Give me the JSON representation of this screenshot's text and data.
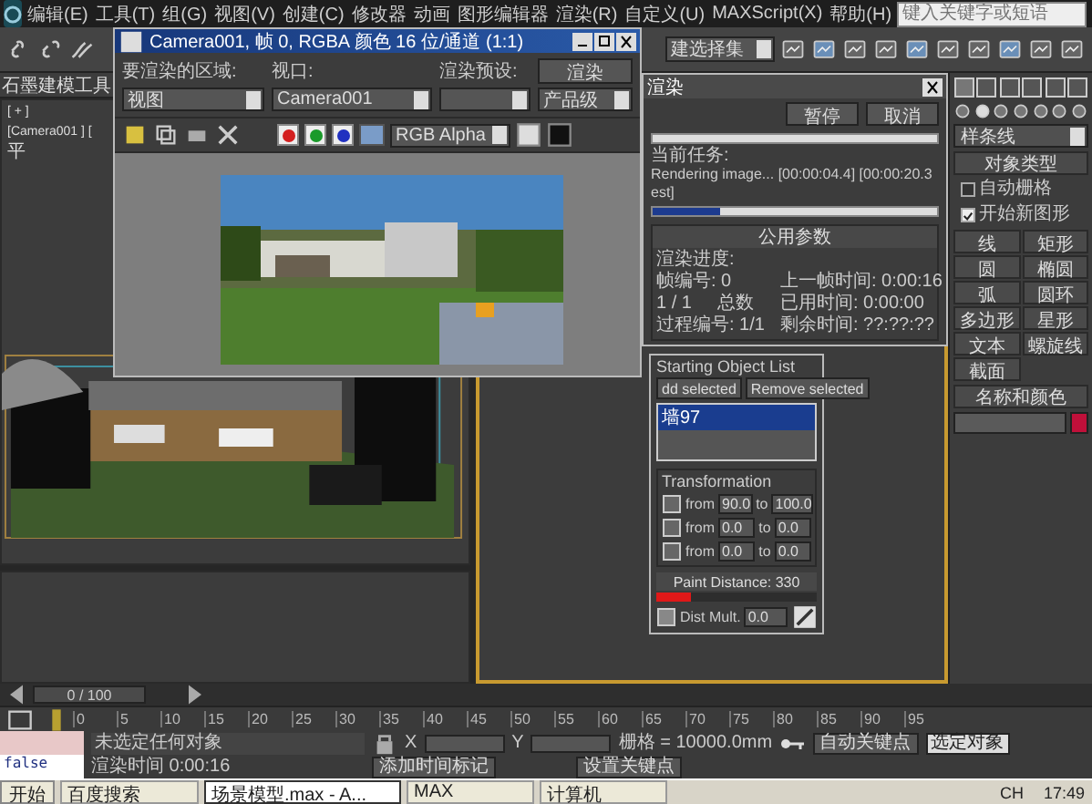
{
  "menu_bar": {
    "items": [
      "编辑(E)",
      "工具(T)",
      "组(G)",
      "视图(V)",
      "创建(C)",
      "修改器",
      "动画",
      "图形编辑器",
      "渲染(R)",
      "自定义(U)",
      "MAXScript(X)",
      "帮助(H)"
    ],
    "search_placeholder": "键入关键字或短语"
  },
  "toolbar": {
    "selection_set": "建选择集"
  },
  "ribbon": {
    "tab": "石墨建模工具"
  },
  "viewport": {
    "label": "[ + ] [Camera001 ] [ 平"
  },
  "frame_window": {
    "title": "Camera001, 帧 0, RGBA 颜色 16 位/通道 (1:1)",
    "area_label": "要渲染的区域:",
    "area_value": "视图",
    "viewport_label": "视口:",
    "viewport_value": "Camera001",
    "preset_label": "渲染预设:",
    "render_button": "渲染",
    "quality_value": "产品级",
    "channels": [
      {
        "color": "#d42020"
      },
      {
        "color": "#1a9a2a"
      },
      {
        "color": "#2030c0"
      }
    ],
    "display_value": "RGB Alpha"
  },
  "render_dialog": {
    "title": "渲染",
    "buttons": [
      "暂停",
      "取消"
    ],
    "task_label": "当前任务:",
    "task": "Rendering image... [00:00:04.4] [00:00:20.3 est]",
    "task_progress": {
      "level": 0.24
    },
    "section_title": "公用参数",
    "progress_label": "渲染进度:",
    "frame_label": "帧编号: 0",
    "count": "1 / 1",
    "total_label": "总数",
    "pass_label": "过程编号: 1/1",
    "stats": [
      "上一帧时间: 0:00:16",
      "已用时间: 0:00:00",
      "剩余时间: ??:??:??"
    ]
  },
  "particle_panel": {
    "list_title": "Starting Object List",
    "buttons": [
      "dd selected",
      "Remove selected"
    ],
    "objects": [
      {
        "name": "墙97",
        "selected": true
      }
    ],
    "transformation_title": "Transformation",
    "rows": [
      {
        "from_label": "from",
        "from": "90.0",
        "to_label": "to",
        "to": "100.0"
      },
      {
        "from_label": "from",
        "from": "0.0",
        "to_label": "to",
        "to": "0.0"
      },
      {
        "from_label": "from",
        "from": "0.0",
        "to_label": "to",
        "to": "0.0"
      }
    ],
    "paint_distance": "Paint Distance: 330",
    "paint_bar": {
      "level": 0.22
    },
    "dist_mult_label": "Dist Mult.",
    "dist_mult": "0.0"
  },
  "command_panel": {
    "category": "样条线",
    "object_type_title": "对象类型",
    "options": [
      {
        "label": "自动栅格",
        "checked": false
      },
      {
        "label": "开始新图形",
        "checked": true
      }
    ],
    "buttons": [
      "线",
      "矩形",
      "圆",
      "椭圆",
      "弧",
      "圆环",
      "多边形",
      "星形",
      "文本",
      "螺旋线",
      "截面"
    ],
    "name_color_title": "名称和颜色"
  },
  "timeline": {
    "slider": {
      "label": "0 / 100",
      "level": 0
    },
    "ticks": [
      "0",
      "5",
      "10",
      "15",
      "20",
      "25",
      "30",
      "35",
      "40",
      "45",
      "50",
      "55",
      "60",
      "65",
      "70",
      "75",
      "80",
      "85",
      "90",
      "95"
    ]
  },
  "status_bar": {
    "listener_output": "false",
    "prompt": "未选定任何对象",
    "render_time": "渲染时间 0:00:16",
    "x_label": "X",
    "y_label": "Y",
    "grid": "栅格 = 10000.0mm",
    "add_time_tag": "添加时间标记",
    "auto_key": "自动关键点",
    "key_mode": "选定对象",
    "set_key": "设置关键点"
  },
  "taskbar": {
    "start": "开始",
    "tasks": [
      {
        "label": "百度搜索",
        "selected": false
      },
      {
        "label": "场景模型.max - A...",
        "selected": true
      },
      {
        "label": "MAX",
        "selected": false
      },
      {
        "label": "计算机",
        "selected": false
      }
    ],
    "tray_lang": "CH",
    "clock": "17:49"
  }
}
